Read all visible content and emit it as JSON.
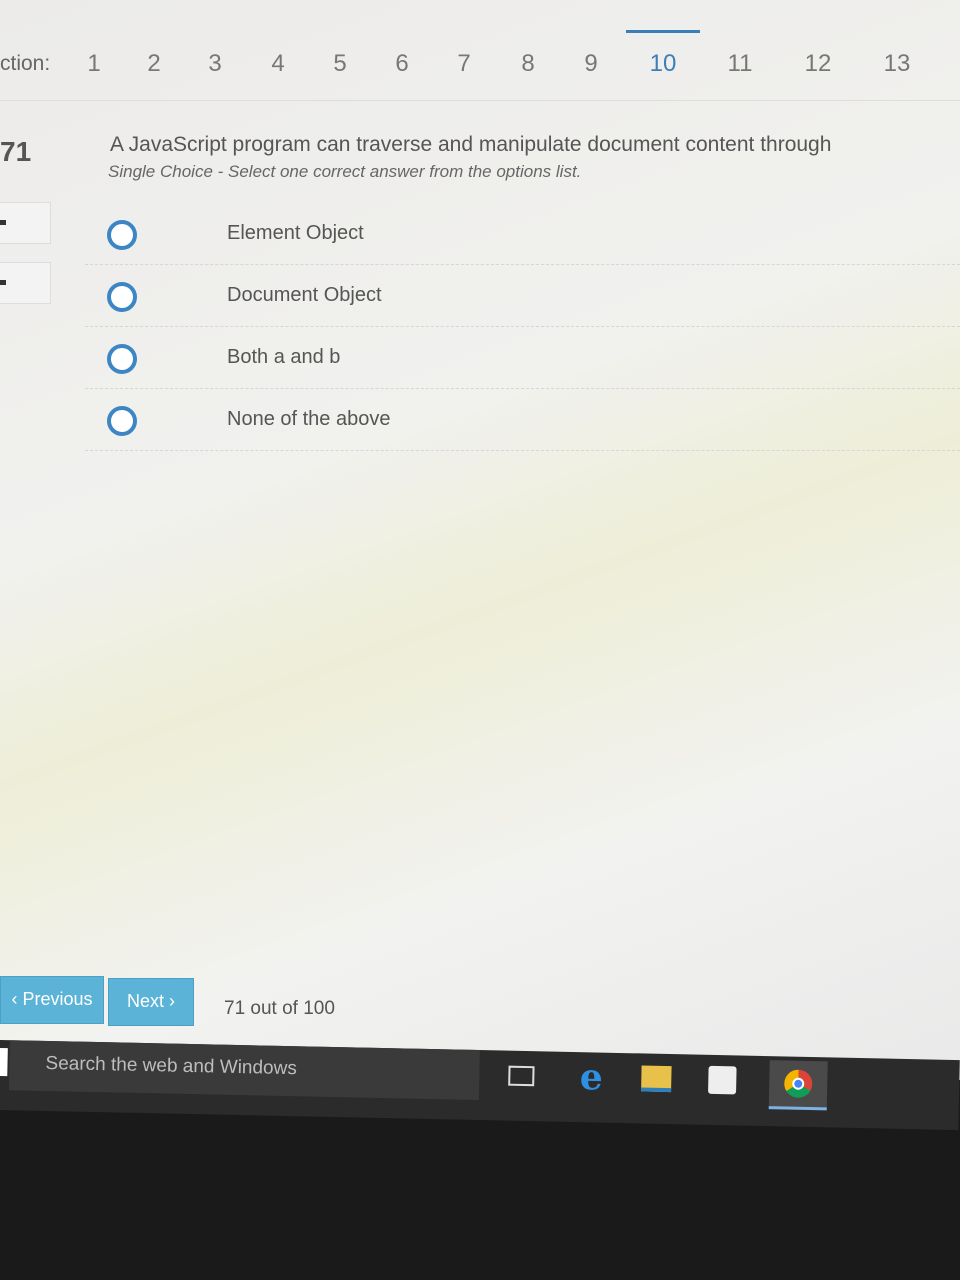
{
  "section_nav": {
    "label": "ction:",
    "numbers": [
      "1",
      "2",
      "3",
      "4",
      "5",
      "6",
      "7",
      "8",
      "9",
      "10",
      "11",
      "12",
      "13"
    ],
    "active": "10"
  },
  "question": {
    "number": "71",
    "text": "A JavaScript program can traverse and manipulate document content through",
    "subtitle": "Single Choice - Select one correct answer from the options list.",
    "options": [
      "Element Object",
      "Document Object",
      "Both a and b",
      "None of the above"
    ]
  },
  "footer": {
    "previous_label": "‹ Previous",
    "next_label": "Next ›",
    "progress": "71 out of 100"
  },
  "taskbar": {
    "search_placeholder": "Search the web and Windows",
    "edge_glyph": "e"
  },
  "colors": {
    "accent": "#3c86c6",
    "button": "#5bb4d8"
  }
}
